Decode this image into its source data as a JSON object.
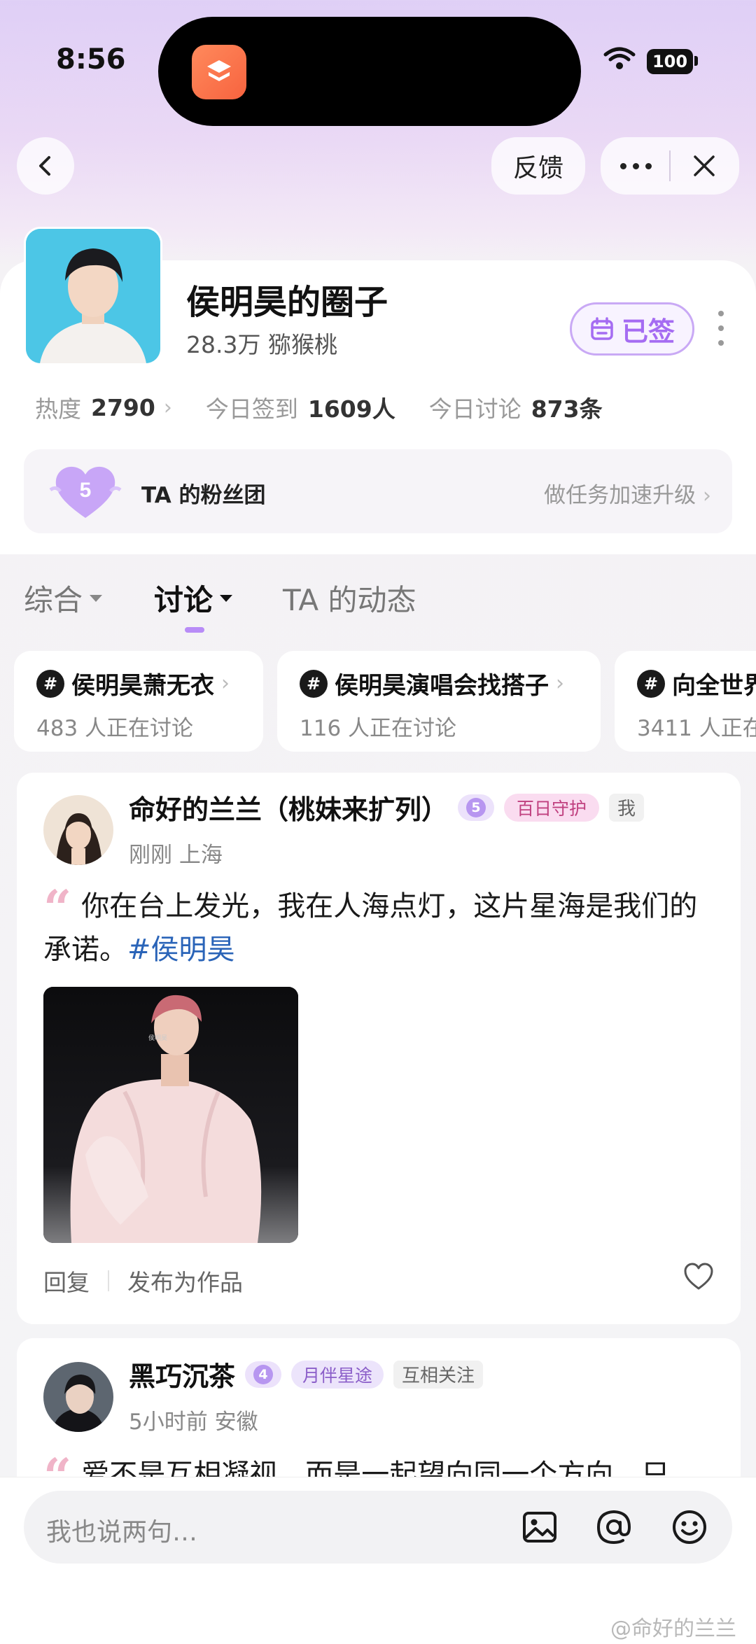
{
  "status_bar": {
    "time": "8:56",
    "battery": "100"
  },
  "nav": {
    "feedback_label": "反馈"
  },
  "circle": {
    "title": "侯明昊的圈子",
    "subtitle": "28.3万 猕猴桃",
    "signed_label": "已签",
    "stats": [
      {
        "label": "热度",
        "value": "2790"
      },
      {
        "label": "今日签到",
        "value": "1609人"
      },
      {
        "label": "今日讨论",
        "value": "873条"
      }
    ],
    "fan_club": {
      "level": "5",
      "label": "TA 的粉丝团",
      "hint": "做任务加速升级"
    }
  },
  "tabs": [
    {
      "label": "综合"
    },
    {
      "label": "讨论"
    },
    {
      "label": "TA 的动态"
    }
  ],
  "topics": [
    {
      "title": "侯明昊萧无衣",
      "count": "483 人正在讨论"
    },
    {
      "title": "侯明昊演唱会找搭子",
      "count": "116 人正在讨论"
    },
    {
      "title": "向全世界",
      "count": "3411 人正在"
    }
  ],
  "posts": [
    {
      "author": "命好的兰兰（桃妹来扩列）",
      "level": "5",
      "badge": "百日守护",
      "tag": "我",
      "meta": "刚刚 上海",
      "text": "你在台上发光，我在人海点灯，这片星海是我们的承诺。",
      "hashtag": "#侯明昊",
      "image_text": "侯明昊",
      "reply_label": "回复",
      "publish_label": "发布为作品"
    },
    {
      "author": "黑巧沉茶",
      "level": "4",
      "badge": "月伴星途",
      "tag": "互相关注",
      "meta": "5小时前 安徽",
      "text": "爱不是互相凝视，而是一起望向同一个方向，只"
    }
  ],
  "composer": {
    "placeholder": "我也说两句…"
  },
  "watermark": "@命好的兰兰",
  "colors": {
    "accent": "#a56cf2",
    "hashtag": "#2a64b8",
    "badge_pink": "#fadcf0"
  }
}
